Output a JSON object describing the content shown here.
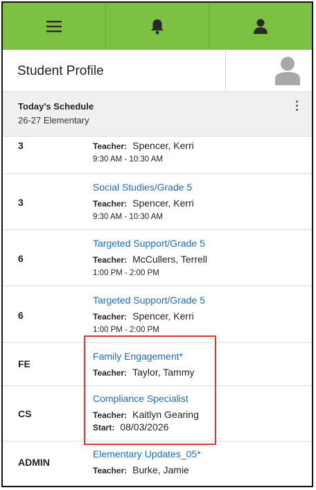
{
  "topbar": {
    "menu_icon": "menu-icon",
    "bell_icon": "bell-icon",
    "user_icon": "user-icon"
  },
  "profile": {
    "title": "Student Profile",
    "avatar_icon": "avatar-icon"
  },
  "schedule": {
    "title": "Today's Schedule",
    "subtitle": "26-27 Elementary",
    "menu_icon": "more-vertical-icon"
  },
  "rows": [
    {
      "period": "3",
      "course": "",
      "teacher_label": "Teacher:",
      "teacher": "Spencer, Kerri",
      "time": "9:30 AM - 10:30 AM"
    },
    {
      "period": "3",
      "course": "Social Studies/Grade 5",
      "teacher_label": "Teacher:",
      "teacher": "Spencer, Kerri",
      "time": "9:30 AM - 10:30 AM"
    },
    {
      "period": "6",
      "course": "Targeted Support/Grade 5",
      "teacher_label": "Teacher:",
      "teacher": "McCullers, Terrell",
      "time": "1:00 PM - 2:00 PM"
    },
    {
      "period": "6",
      "course": "Targeted Support/Grade 5",
      "teacher_label": "Teacher:",
      "teacher": "Spencer, Kerri",
      "time": "1:00 PM - 2:00 PM"
    },
    {
      "period": "FE",
      "course": "Family Engagement*",
      "teacher_label": "Teacher:",
      "teacher": "Taylor, Tammy",
      "time": ""
    },
    {
      "period": "CS",
      "course": "Compliance Specialist",
      "teacher_label": "Teacher:",
      "teacher": "Kaitlyn Gearing",
      "start_label": "Start:",
      "start": "08/03/2026"
    },
    {
      "period": "ADMIN",
      "course": "Elementary Updates_05*",
      "teacher_label": "Teacher:",
      "teacher": "Burke, Jamie",
      "time": ""
    }
  ],
  "colors": {
    "topbar": "#7cc142",
    "link": "#1f6bb5",
    "highlight": "#e23333"
  }
}
